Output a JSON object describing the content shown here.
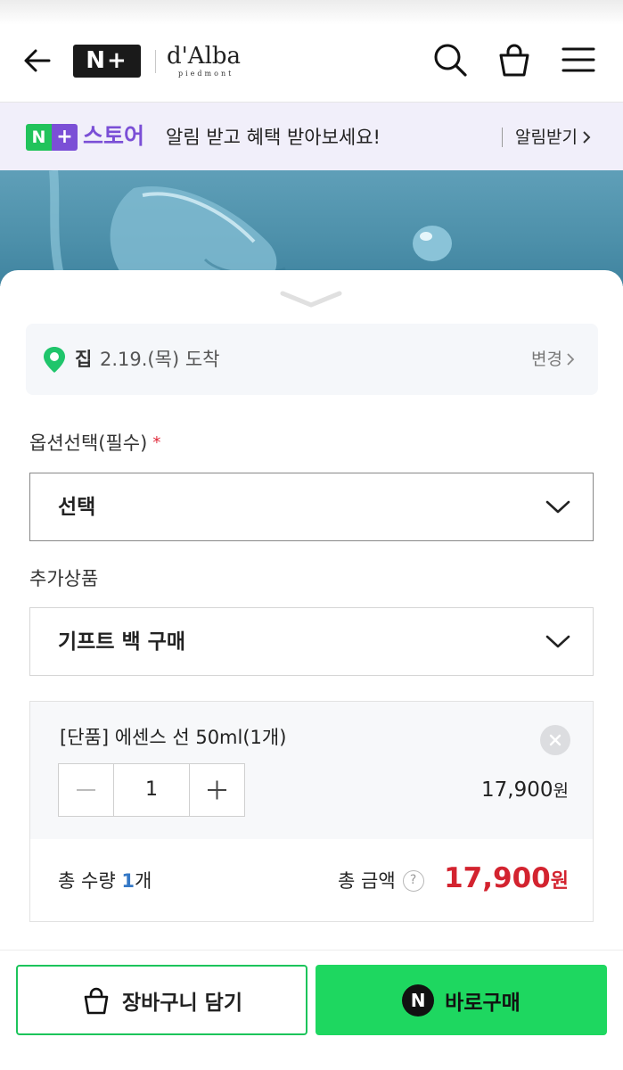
{
  "header": {
    "logo_text": "N+",
    "brand_name": "d'Alba",
    "brand_sub": "piedmont",
    "icons": [
      "back-arrow-icon",
      "search-icon",
      "shopping-bag-icon",
      "menu-icon"
    ]
  },
  "banner": {
    "logo_n": "N",
    "logo_plus": "+",
    "store": "스토어",
    "message": "알림 받고 혜택 받아보세요!",
    "action": "알림받기"
  },
  "delivery": {
    "place": "집",
    "date": "2.19.(목) 도착",
    "change": "변경"
  },
  "options": {
    "label": "옵션선택(필수)",
    "required_mark": "*",
    "selected": "선택"
  },
  "addon": {
    "label": "추가상품",
    "selected": "기프트 백 구매"
  },
  "item": {
    "name": "[단품] 에센스 선 50ml(1개)",
    "quantity": "1",
    "price": "17,900",
    "currency": "원"
  },
  "summary": {
    "qty_prefix": "총 수량 ",
    "qty_value": "1",
    "qty_suffix": "개",
    "total_label": "총 금액",
    "help": "?",
    "total_price": "17,900",
    "currency": "원"
  },
  "actions": {
    "cart": "장바구니 담기",
    "buy_badge": "N",
    "buy": "바로구매"
  },
  "colors": {
    "naver_green": "#1ed760",
    "plus_purple": "#7b4fd6",
    "price_red": "#d3232f",
    "qty_blue": "#3478c6",
    "banner_bg": "#f1effa"
  }
}
